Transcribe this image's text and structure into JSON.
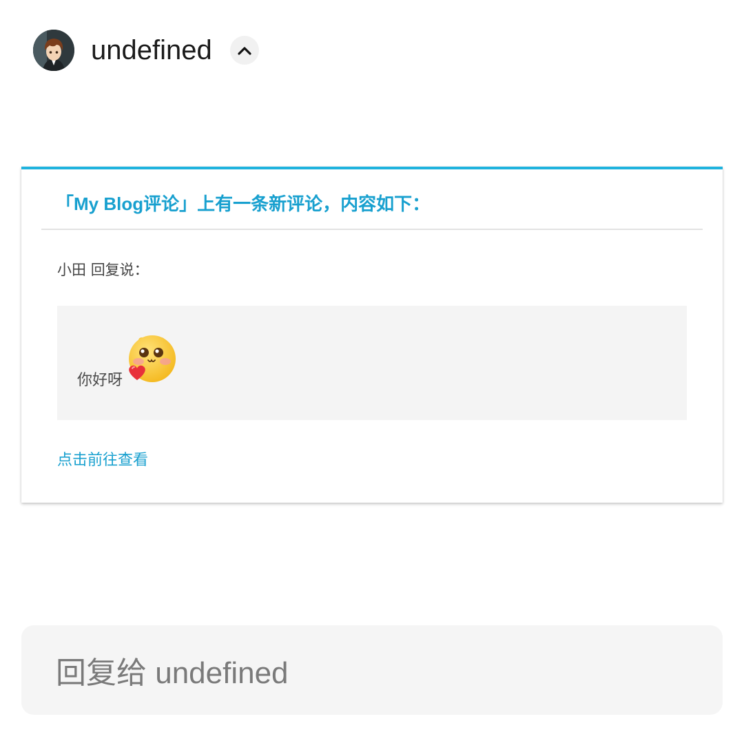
{
  "header": {
    "sender": "undefined",
    "collapse_icon": "chevron-up-icon"
  },
  "email": {
    "title": "「My Blog评论」上有一条新评论，内容如下：",
    "reply_author": "小田",
    "reply_verb": "回复说：",
    "comment_text": "你好呀",
    "emoji": "blushing-heart-emoji-icon",
    "view_link": "点击前往查看"
  },
  "reply": {
    "placeholder": "回复给 undefined"
  },
  "colors": {
    "accent": "#1fb3de",
    "link": "#18a0cf",
    "quote_bg": "#f4f4f4",
    "reply_bg": "#f5f5f5"
  }
}
